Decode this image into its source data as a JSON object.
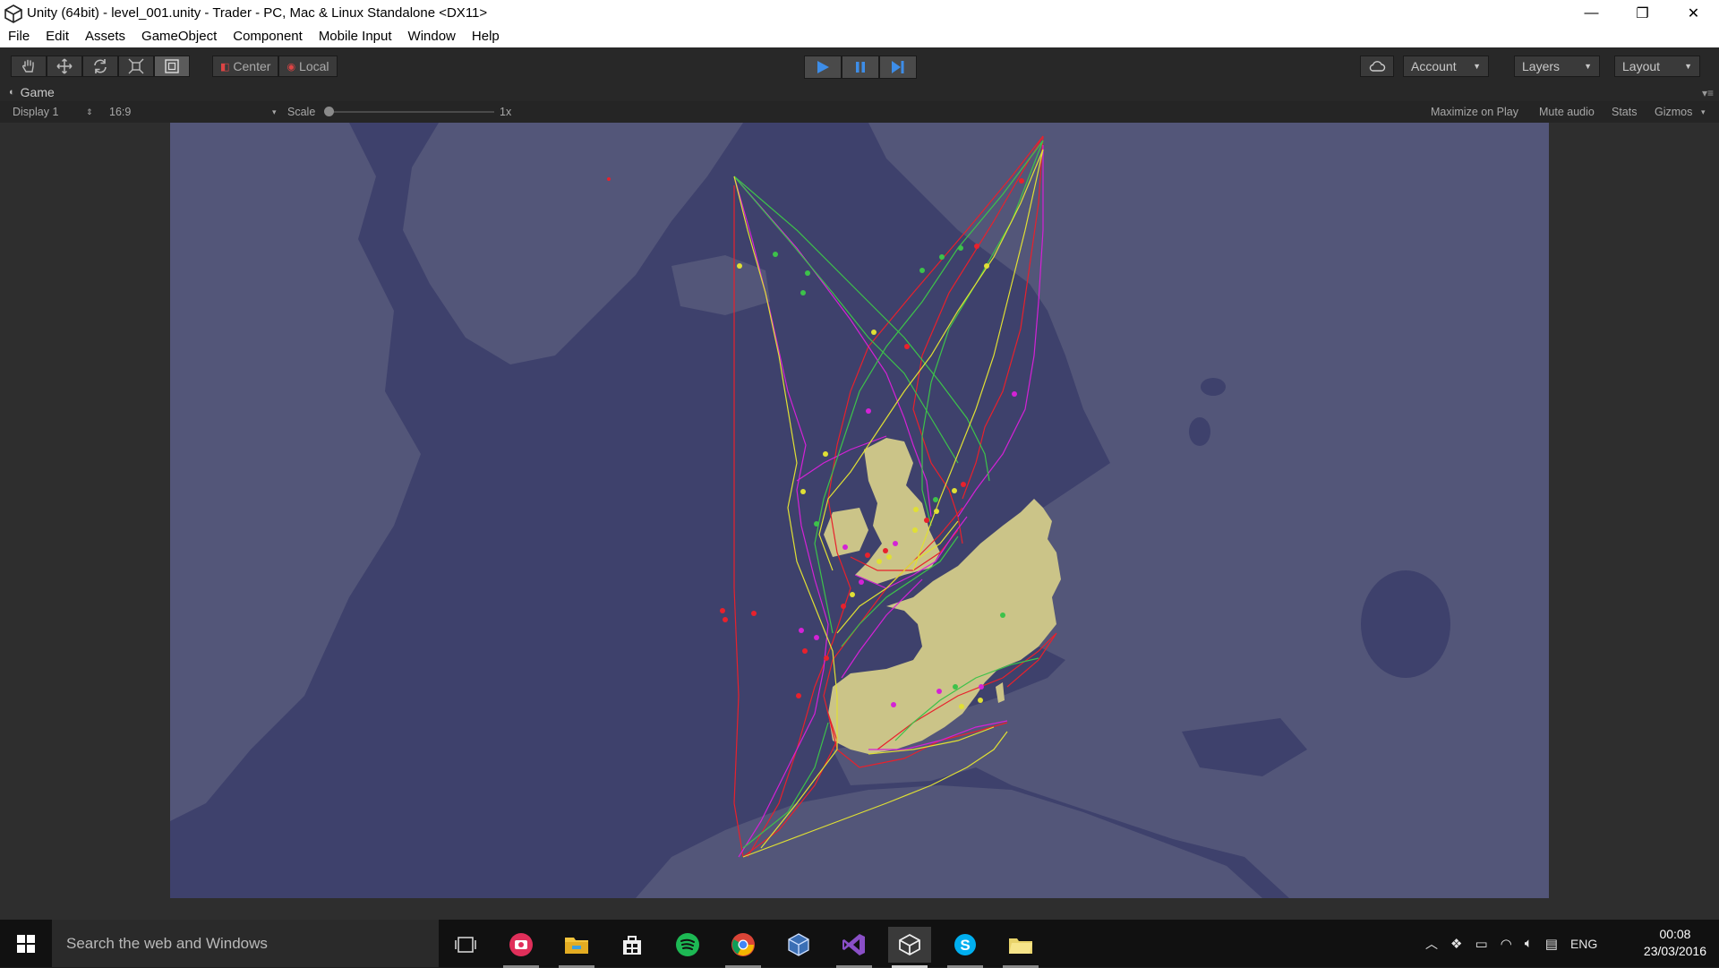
{
  "window": {
    "title": "Unity (64bit) - level_001.unity - Trader - PC, Mac & Linux Standalone <DX11>",
    "minimize": "—",
    "restore": "❐",
    "close": "✕"
  },
  "menu": {
    "items": [
      "File",
      "Edit",
      "Assets",
      "GameObject",
      "Component",
      "Mobile Input",
      "Window",
      "Help"
    ]
  },
  "toolbar": {
    "center_label": "Center",
    "local_label": "Local",
    "account_label": "Account",
    "layers_label": "Layers",
    "layout_label": "Layout",
    "accent": "#3d8de8"
  },
  "game_view": {
    "tab_label": "Game",
    "display": "Display 1",
    "aspect": "16:9",
    "scale_label": "Scale",
    "scale_value": "1x",
    "maximize": "Maximize on Play",
    "mute": "Mute audio",
    "stats": "Stats",
    "gizmos": "Gizmos"
  },
  "map": {
    "ocean_color": "#3e416c",
    "land_dim_color": "#535679",
    "land_highlight_color": "#cbc488",
    "route_colors": [
      "#e8212c",
      "#d422d6",
      "#3dc24a",
      "#e0e034"
    ]
  },
  "taskbar": {
    "search_placeholder": "Search the web and Windows",
    "language": "ENG",
    "time": "00:08",
    "date": "23/03/2016"
  }
}
